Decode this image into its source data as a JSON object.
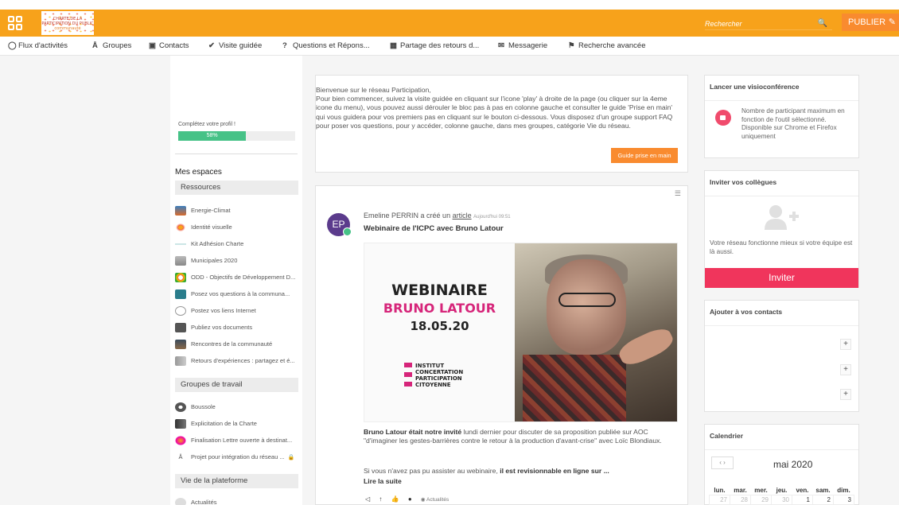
{
  "topbar": {
    "logo_line1": "CHARTE DE LA",
    "logo_line2": "PARTICIPATION DU PUBLIC",
    "logo_line3": "communauté",
    "search_placeholder": "Rechercher",
    "publish_label": "PUBLIER"
  },
  "nav": [
    {
      "label": "Flux d'activités",
      "icon": "globe-icon"
    },
    {
      "label": "Groupes",
      "icon": "group-icon"
    },
    {
      "label": "Contacts",
      "icon": "contacts-icon"
    },
    {
      "label": "Visite guidée",
      "icon": "check-circle-icon"
    },
    {
      "label": "Questions et Répons...",
      "icon": "question-icon"
    },
    {
      "label": "Partage des retours d...",
      "icon": "grid-icon"
    },
    {
      "label": "Messagerie",
      "icon": "envelope-icon"
    },
    {
      "label": "Recherche avancée",
      "icon": "signpost-icon"
    }
  ],
  "sidebar": {
    "profile_label": "Complétez votre profil !",
    "profile_percent": 58,
    "profile_percent_text": "58%",
    "mes_espaces": "Mes espaces",
    "sections": [
      {
        "title": "Ressources",
        "items": [
          "Energie-Climat",
          "Identité visuelle",
          "Kit Adhésion Charte",
          "Municipales 2020",
          "ODD - Objectifs de Développement D...",
          "Posez vos questions à la communa...",
          "Postez vos liens Internet",
          "Publiez vos documents",
          "Rencontres de la communauté",
          "Retours d'expériences : partagez et é..."
        ]
      },
      {
        "title": "Groupes de travail",
        "items": [
          "Boussole",
          "Explicitation de la Charte",
          "Finalisation Lettre ouverte à destinat...",
          "Projet pour intégration du réseau ..."
        ]
      },
      {
        "title": "Vie de la plateforme",
        "items": [
          "Actualités"
        ]
      }
    ]
  },
  "welcome": {
    "text": "Bienvenue sur le réseau Participation,\nPour bien commencer, suivez la visite guidée en cliquant sur l'icone 'play' à droite de la page (ou cliquer sur la 4eme icone du menu), vous pouvez aussi dérouler le bloc pas à pas en colonne gauche et consulter le guide 'Prise en main' qui vous guidera pour vos premiers pas en cliquant sur le bouton ci-dessous. Vous disposez d'un groupe support FAQ pour poser vos questions, pour y accéder, colonne gauche, dans mes groupes, catégorie Vie du réseau.",
    "button": "Guide prise en main"
  },
  "post": {
    "avatar_initials": "EP",
    "author": "Emeline PERRIN",
    "action": "a créé un",
    "link": "article",
    "time": "Aujourd'hui 09:51",
    "title": "Webinaire de l'ICPC avec Bruno Latour",
    "image": {
      "line1": "WEBINAIRE",
      "line2": "BRUNO LATOUR",
      "line3": "18.05.20",
      "inst1": "INSTITUT",
      "inst2": "CONCERTATION",
      "inst3": "PARTICIPATION",
      "inst4": "CITOYENNE"
    },
    "body_bold": "Bruno Latour était notre invité",
    "body_rest": " lundi dernier pour discuter de sa proposition publiée sur AOC \"d'imaginer les gestes-barrières contre le retour à la production d'avant-crise\" avec Loïc Blondiaux.",
    "body2_start": "Si vous n'avez pas pu assister au webinaire, ",
    "body2_bold": "il est revisionnable en ligne sur ...",
    "read_more": "Lire la suite",
    "tag": "Actualités"
  },
  "right": {
    "visio_title": "Lancer une visioconférence",
    "visio_text": "Nombre de participant maximum en fonction de l'outil sélectionné. Disponible sur Chrome et Firefox uniquement",
    "invite_title": "Inviter vos collègues",
    "invite_text": "Votre réseau fonctionne mieux si votre équipe est là aussi.",
    "invite_button": "Inviter",
    "contacts_title": "Ajouter à vos contacts",
    "calendar_title": "Calendrier",
    "calendar_nav": "‹  ›",
    "calendar_month": "mai 2020",
    "calendar_days": [
      "lun.",
      "mar.",
      "mer.",
      "jeu.",
      "ven.",
      "sam.",
      "dim."
    ],
    "calendar_row": [
      {
        "d": "27",
        "cur": false
      },
      {
        "d": "28",
        "cur": false
      },
      {
        "d": "29",
        "cur": false
      },
      {
        "d": "30",
        "cur": false
      },
      {
        "d": "1",
        "cur": true
      },
      {
        "d": "2",
        "cur": true
      },
      {
        "d": "3",
        "cur": true
      }
    ]
  },
  "colors": {
    "topbar": "#f7a21b",
    "publish": "#f98b2f",
    "invite": "#f0355c",
    "progress": "#46c287"
  }
}
